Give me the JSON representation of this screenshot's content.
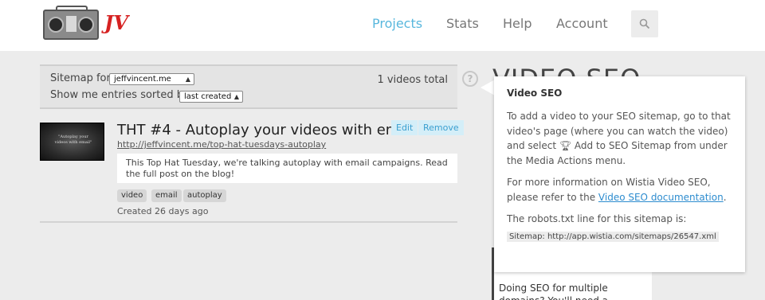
{
  "header": {
    "logo_text": "JV",
    "nav": [
      {
        "label": "Projects",
        "active": true
      },
      {
        "label": "Stats",
        "active": false
      },
      {
        "label": "Help",
        "active": false
      },
      {
        "label": "Account",
        "active": false
      }
    ],
    "search_icon": "search-icon"
  },
  "filter": {
    "sitemap_label": "Sitemap for",
    "sitemap_value": "jeffvincent.me",
    "sort_label": "Show me entries sorted by",
    "sort_value": "last created",
    "total": "1 videos total"
  },
  "video": {
    "thumb_caption": "\"Autoplay your videos with email\"",
    "title": "THT #4 - Autoplay your videos with email",
    "url": "http://jeffvincent.me/top-hat-tuesdays-autoplay",
    "edit_label": "Edit",
    "remove_label": "Remove",
    "description": "This Top Hat Tuesday, we're talking autoplay with email campaigns. Read the full post on the blog!",
    "tags": [
      "video",
      "email",
      "autoplay"
    ],
    "created": "Created 26 days ago"
  },
  "help": {
    "icon_glyph": "?",
    "heading": "VIDEO SEO"
  },
  "tooltip": {
    "title": "Video SEO",
    "p1_before": "To add a video to your SEO sitemap, go to that video's page (where you can watch the video) and select ",
    "p1_after": " Add to SEO Sitemap from under the Media Actions menu.",
    "p2_before": "For more information on Wistia Video SEO, please refer to the ",
    "p2_link": "Video SEO documentation",
    "p2_after": ".",
    "p3": "The robots.txt line for this sitemap is:",
    "code": "Sitemap: http://app.wistia.com/sitemaps/26547.xml"
  },
  "side": {
    "text": "Doing SEO for multiple domains? You'll need a"
  },
  "colors": {
    "accent": "#58b7dd",
    "link": "#2d8ccf",
    "logo_red": "#d62222"
  }
}
